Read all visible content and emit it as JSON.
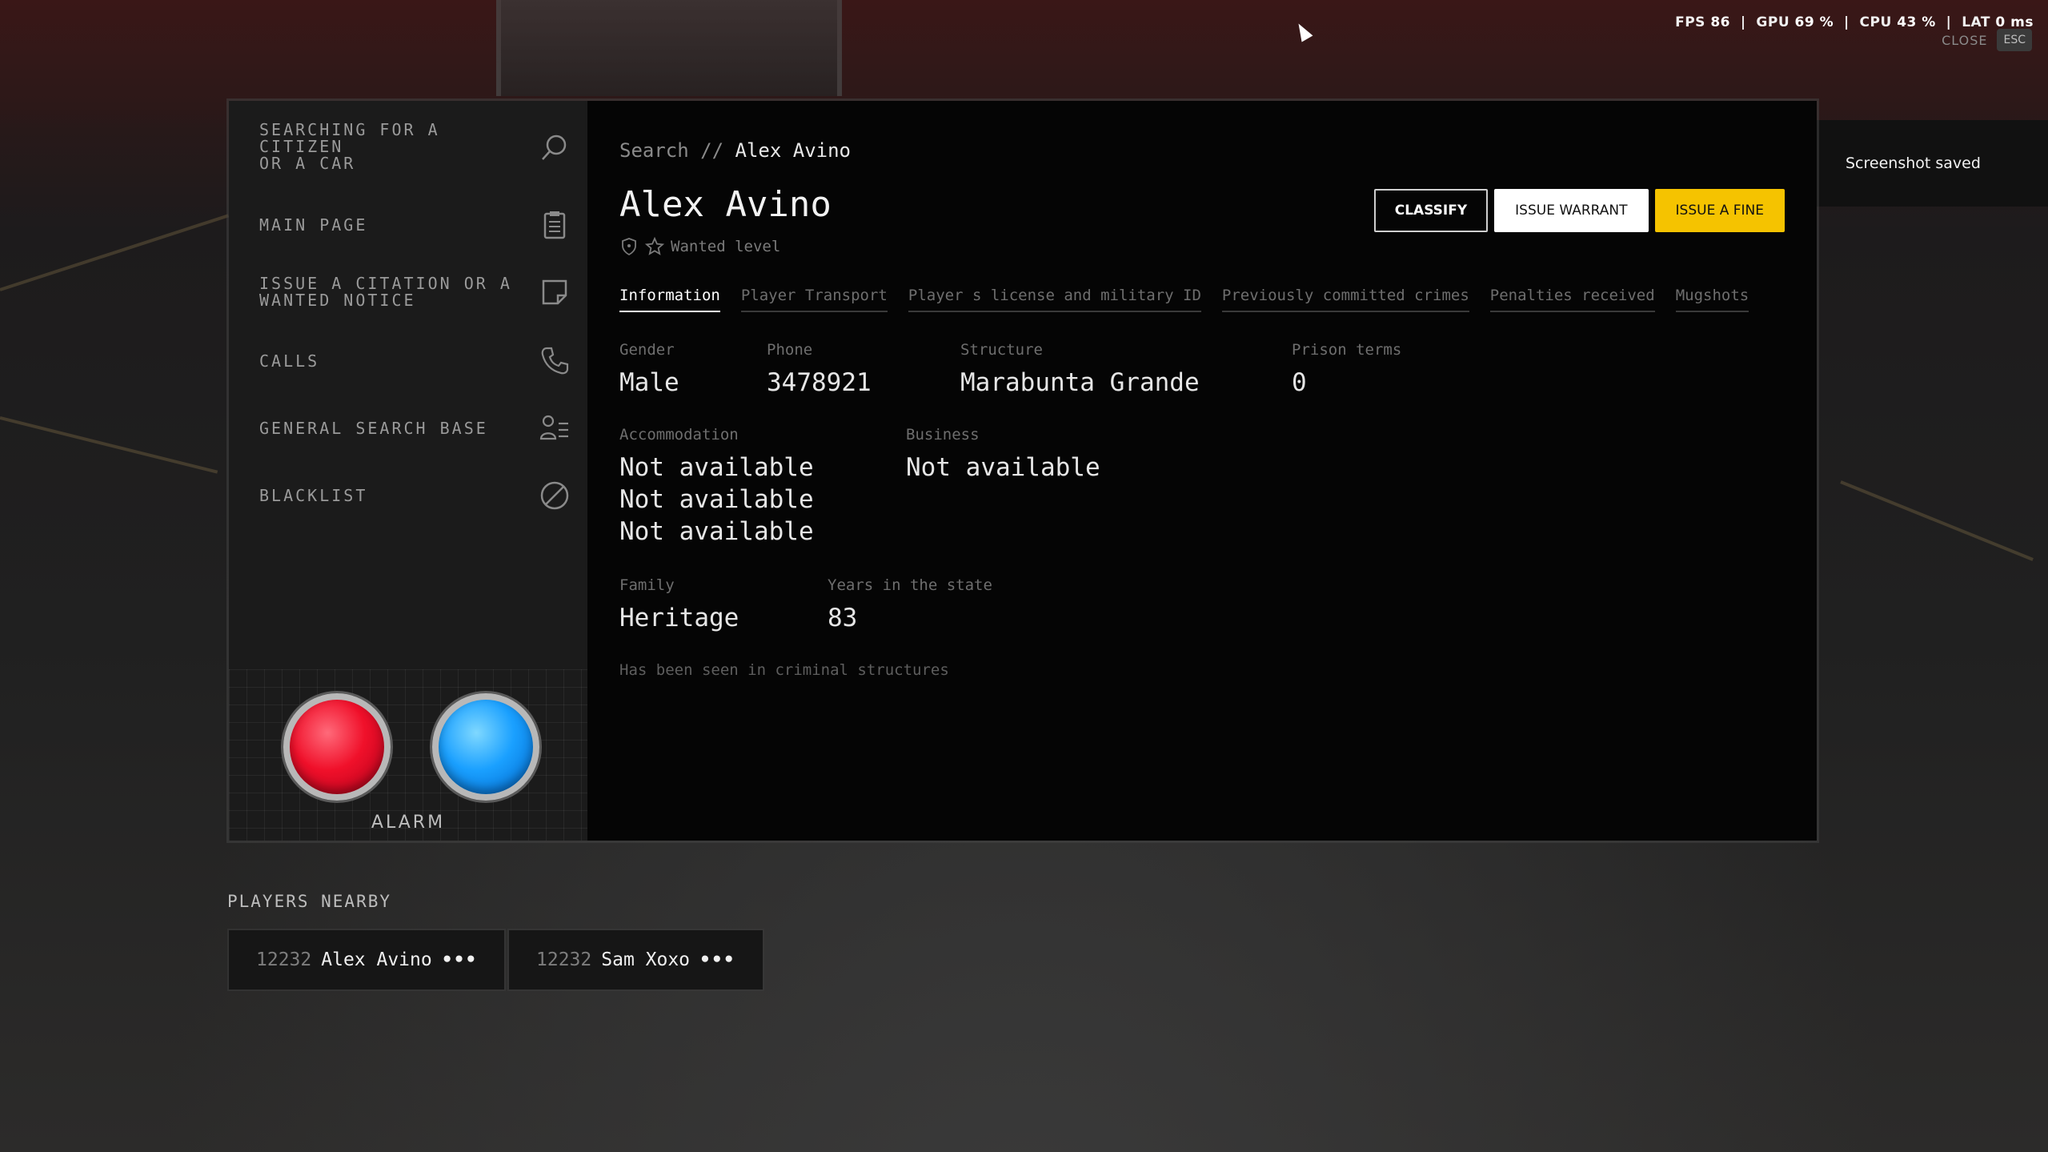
{
  "hud": {
    "fps_label": "FPS",
    "fps_value": "86",
    "gpu_label": "GPU",
    "gpu_value": "69 %",
    "cpu_label": "CPU",
    "cpu_value": "43 %",
    "lat_label": "LAT",
    "lat_value": "0 ms",
    "close_label": "CLOSE",
    "esc_key": "ESC"
  },
  "toast": {
    "text": "Screenshot saved"
  },
  "sidebar": {
    "items": [
      {
        "label": "SEARCHING FOR A CITIZEN\nOR A CAR",
        "icon": "search-icon"
      },
      {
        "label": "MAIN PAGE",
        "icon": "clipboard-icon"
      },
      {
        "label": "ISSUE A CITATION OR A WANTED NOTICE",
        "icon": "note-icon"
      },
      {
        "label": "CALLS",
        "icon": "phone-icon"
      },
      {
        "label": "GENERAL SEARCH BASE",
        "icon": "user-list-icon"
      },
      {
        "label": "BLACKLIST",
        "icon": "ban-icon"
      }
    ],
    "alarm_label": "ALARM"
  },
  "breadcrumb": {
    "root": "Search",
    "separator": "//",
    "current": "Alex Avino"
  },
  "profile": {
    "name": "Alex Avino",
    "wanted_label": "Wanted level",
    "wanted_level": 0
  },
  "actions": {
    "classify": "CLASSIFY",
    "issue_warrant": "ISSUE WARRANT",
    "issue_fine": "ISSUE A FINE"
  },
  "tabs": [
    "Information",
    "Player Transport",
    "Player s license and military ID",
    "Previously committed crimes",
    "Penalties received",
    "Mugshots"
  ],
  "info": {
    "gender_label": "Gender",
    "gender": "Male",
    "phone_label": "Phone",
    "phone": "3478921",
    "structure_label": "Structure",
    "structure": "Marabunta Grande",
    "prison_label": "Prison terms",
    "prison": "0",
    "accommodation_label": "Accommodation",
    "accommodation": [
      "Not available",
      "Not available",
      "Not available"
    ],
    "business_label": "Business",
    "business": "Not available",
    "family_label": "Family",
    "family": "Heritage",
    "years_label": "Years in the state",
    "years": "83",
    "note": "Has been seen in criminal structures"
  },
  "players_nearby": {
    "title": "PLAYERS NEARBY",
    "players": [
      {
        "id": "12232",
        "name": "Alex Avino",
        "more": "•••"
      },
      {
        "id": "12232",
        "name": "Sam Xoxo",
        "more": "•••"
      }
    ]
  },
  "colors": {
    "accent_yellow": "#f5c300",
    "alarm_red": "#f0102a",
    "alarm_blue": "#1aa0ff",
    "toast_green": "#76b900"
  }
}
